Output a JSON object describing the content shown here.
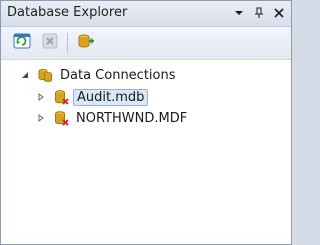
{
  "window": {
    "title": "Database Explorer"
  },
  "title_controls": [
    {
      "name": "dropdown-icon",
      "glyph": "▾"
    },
    {
      "name": "pin-icon",
      "glyph": "📌"
    },
    {
      "name": "close-icon",
      "glyph": "×"
    }
  ],
  "toolbar": {
    "buttons": [
      {
        "name": "refresh-icon"
      },
      {
        "name": "stop-icon"
      },
      {
        "name": "connect-database-icon"
      }
    ]
  },
  "tree": {
    "root": {
      "label": "Data Connections",
      "icon": "data-connections-icon",
      "expanded": true
    },
    "children": [
      {
        "label": "Audit.mdb",
        "icon": "database-error-icon",
        "selected": true
      },
      {
        "label": "NORTHWND.MDF",
        "icon": "database-error-icon",
        "selected": false
      }
    ]
  },
  "colors": {
    "accent_blue": "#3b73b9",
    "error_red": "#d32020",
    "db_gold": "#d9a322",
    "selection_bg": "#d7e8fb"
  }
}
